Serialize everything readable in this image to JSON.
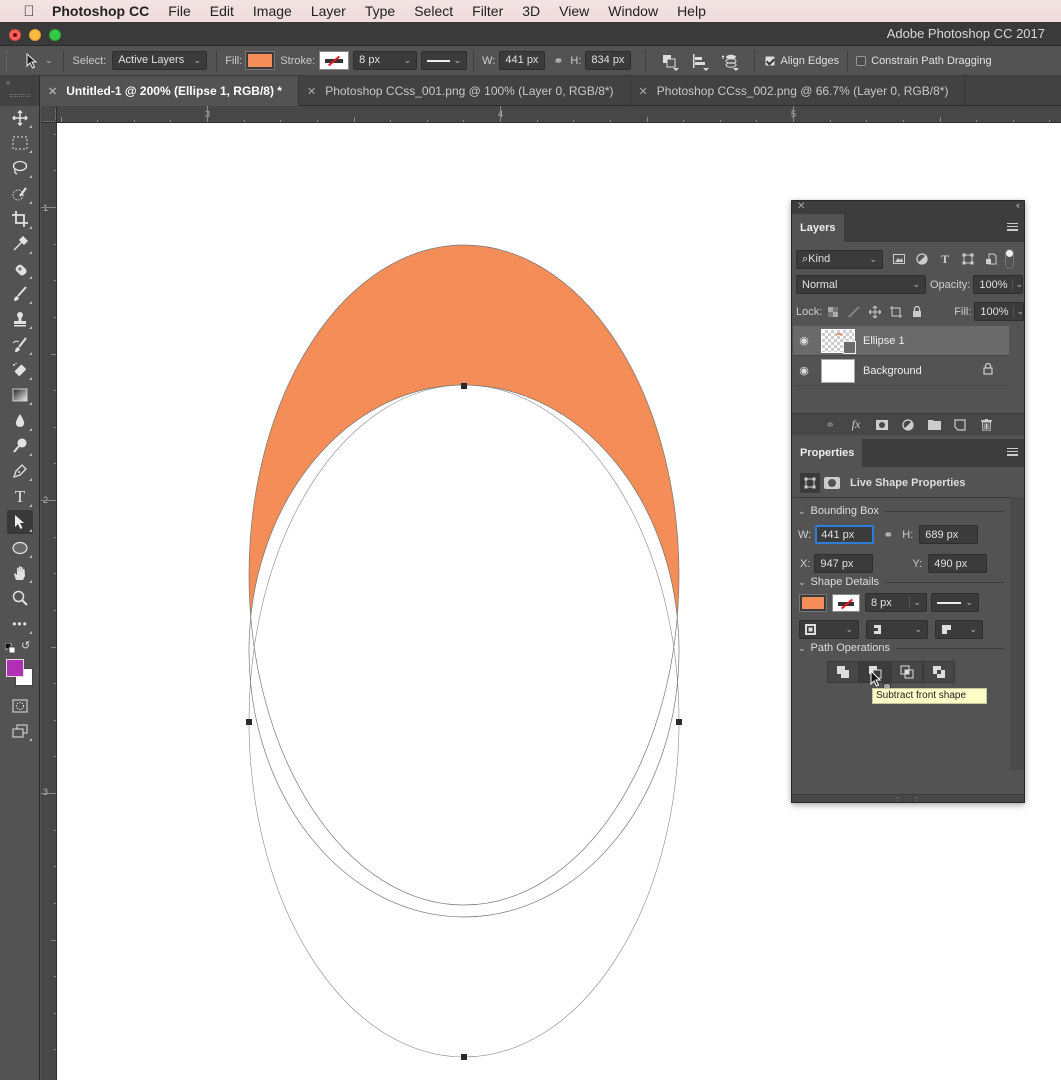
{
  "menubar": {
    "app_name": "Photoshop CC",
    "items": [
      "File",
      "Edit",
      "Image",
      "Layer",
      "Type",
      "Select",
      "Filter",
      "3D",
      "View",
      "Window",
      "Help"
    ]
  },
  "window": {
    "title": "Adobe Photoshop CC 2017"
  },
  "options_bar": {
    "tool_icon": "path-selection-arrow-icon",
    "select_label": "Select:",
    "select_value": "Active Layers",
    "fill_label": "Fill:",
    "fill_color": "#f48d57",
    "stroke_label": "Stroke:",
    "stroke_width": "8 px",
    "w_label": "W:",
    "w_value": "441 px",
    "h_label": "H:",
    "h_value": "834 px",
    "align_edges_label": "Align Edges",
    "align_edges_checked": true,
    "constrain_label": "Constrain Path Dragging",
    "constrain_checked": false
  },
  "tabs": [
    {
      "label": "Untitled-1 @ 200% (Ellipse 1, RGB/8) *",
      "active": true
    },
    {
      "label": "Photoshop CCss_001.png @ 100% (Layer 0, RGB/8*)",
      "active": false
    },
    {
      "label": "Photoshop CCss_002.png @ 66.7% (Layer 0, RGB/8*)",
      "active": false
    }
  ],
  "rulers": {
    "horizontal_labels": [
      "3",
      "4",
      "5"
    ],
    "vertical_labels": [
      "1",
      "2",
      "3"
    ]
  },
  "tools": [
    "move-icon",
    "marquee-icon",
    "lasso-icon",
    "quick-selection-icon",
    "crop-icon",
    "eyedropper-icon",
    "healing-brush-icon",
    "brush-icon",
    "clone-stamp-icon",
    "history-brush-icon",
    "eraser-icon",
    "gradient-icon",
    "blur-icon",
    "dodge-icon",
    "pen-icon",
    "type-icon",
    "path-selection-icon",
    "ellipse-icon",
    "hand-icon",
    "zoom-icon",
    "more-tools-icon"
  ],
  "colors": {
    "foreground": "#b12fb5",
    "background": "#ffffff",
    "shape_fill": "#f48d57"
  },
  "layers_panel": {
    "title": "Layers",
    "filter_kind": "Kind",
    "blend_mode": "Normal",
    "opacity_label": "Opacity:",
    "opacity_value": "100%",
    "lock_label": "Lock:",
    "fill_label": "Fill:",
    "fill_value": "100%",
    "layers": [
      {
        "name": "Ellipse 1",
        "visible": true,
        "selected": true,
        "locked": false
      },
      {
        "name": "Background",
        "visible": true,
        "selected": false,
        "locked": true
      }
    ]
  },
  "properties_panel": {
    "title": "Properties",
    "subtitle": "Live Shape Properties",
    "bounding_box_label": "Bounding Box",
    "w_label": "W:",
    "w_value": "441 px",
    "h_label": "H:",
    "h_value": "689 px",
    "x_label": "X:",
    "x_value": "947 px",
    "y_label": "Y:",
    "y_value": "490 px",
    "shape_details_label": "Shape Details",
    "stroke_width": "8 px",
    "path_operations_label": "Path Operations",
    "path_ops": [
      "combine-shapes-icon",
      "subtract-front-shape-icon",
      "intersect-shape-areas-icon",
      "exclude-overlapping-shapes-icon"
    ]
  },
  "tooltip": {
    "text": "Subtract front shape"
  }
}
